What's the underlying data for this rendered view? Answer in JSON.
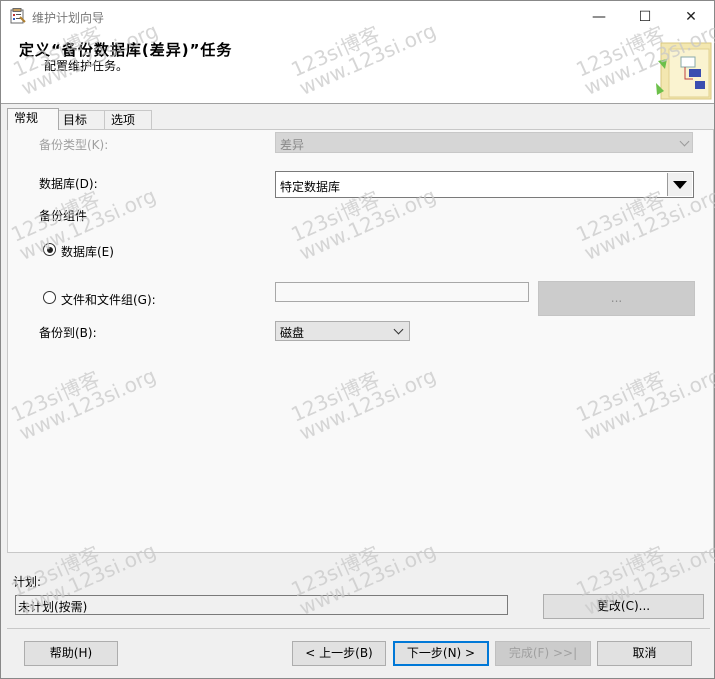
{
  "window": {
    "title": "维护计划向导",
    "minimize_glyph": "—",
    "maximize_glyph": "☐",
    "close_glyph": "✕"
  },
  "header": {
    "title": "定义“备份数据库(差异)”任务",
    "subtitle": "配置维护任务。"
  },
  "tabs": [
    {
      "label": "常规",
      "active": true
    },
    {
      "label": "目标",
      "active": false
    },
    {
      "label": "选项",
      "active": false
    }
  ],
  "form": {
    "backup_type_label": "备份类型(K):",
    "backup_type_value": "差异",
    "database_label": "数据库(D):",
    "database_value": "特定数据库",
    "backup_component_label": "备份组件",
    "radio_database_label": "数据库(E)",
    "radio_files_label": "文件和文件组(G):",
    "files_value": "",
    "browse_label": "...",
    "backup_to_label": "备份到(B):",
    "backup_to_value": "磁盘"
  },
  "schedule": {
    "label": "计划:",
    "value": "未计划(按需)",
    "change_button": "更改(C)..."
  },
  "footer": {
    "help": "帮助(H)",
    "back": "< 上一步(B)",
    "next": "下一步(N) >",
    "finish": "完成(F) >>|",
    "cancel": "取消"
  },
  "watermark": {
    "line1": "123si博客",
    "line2": "www.123si.org"
  },
  "colors": {
    "accent": "#0078d7",
    "disabled_field": "#d6d6d6"
  }
}
